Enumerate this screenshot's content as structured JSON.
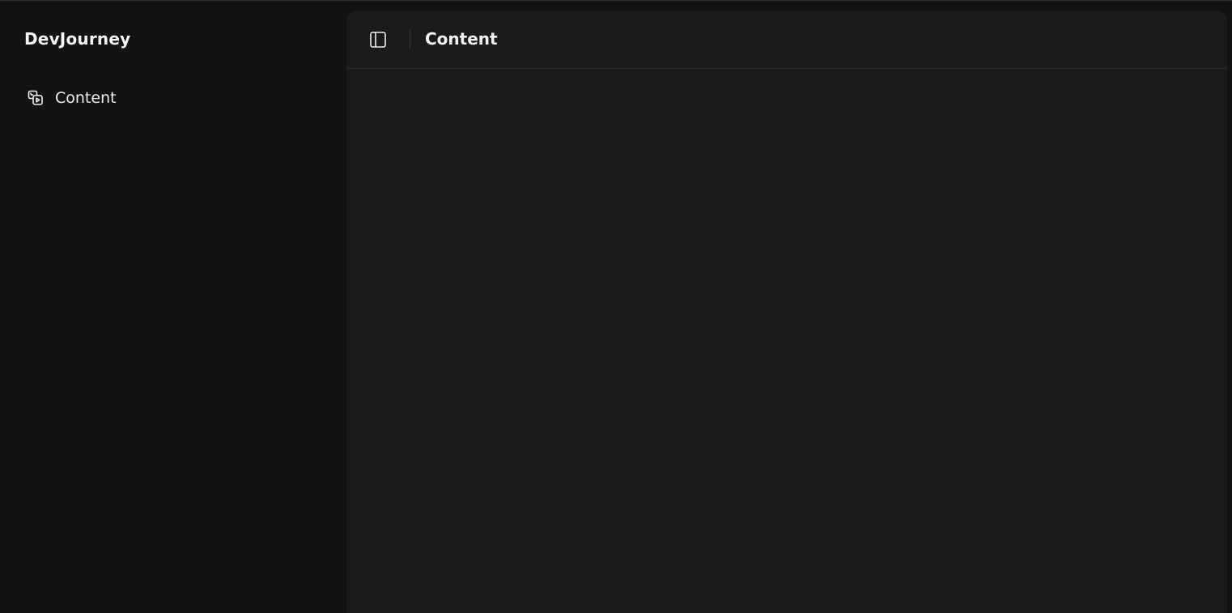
{
  "app": {
    "brand": "DevJourney"
  },
  "sidebar": {
    "items": [
      {
        "label": "Content",
        "icon": "media-content-icon"
      }
    ]
  },
  "header": {
    "title": "Content",
    "toggle_icon": "sidebar-toggle-icon"
  },
  "colors": {
    "sidebar_bg": "#131313",
    "main_bg": "#1b1b1b",
    "text": "#f2f2f2",
    "border": "#2e2e2e"
  }
}
